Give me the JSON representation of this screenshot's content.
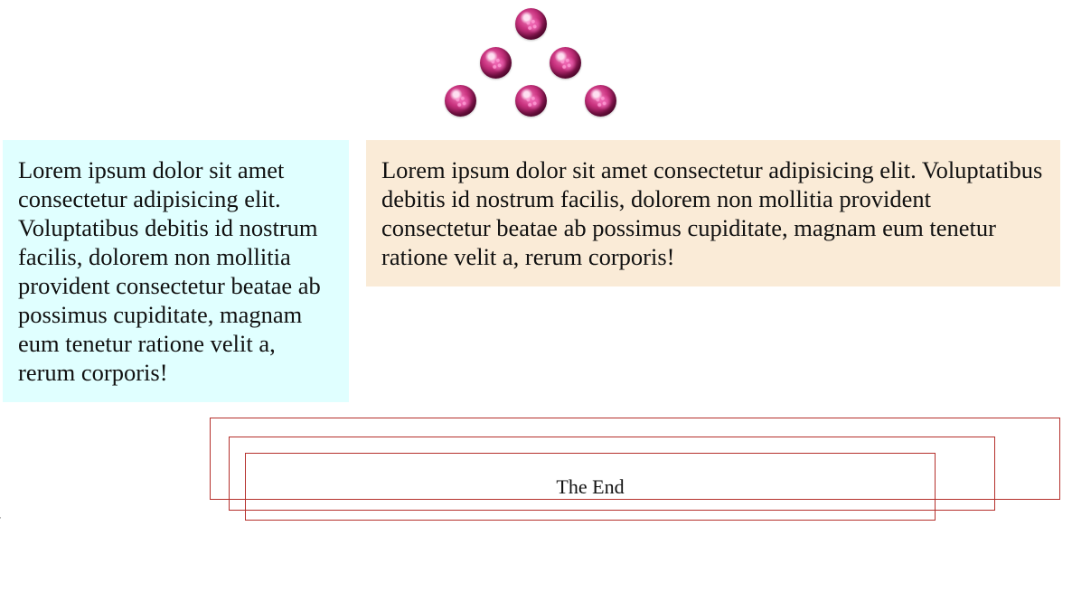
{
  "balls": {
    "count": 6,
    "color": "#c9337f"
  },
  "boxes": {
    "left": {
      "text": "Lorem ipsum dolor sit amet consectetur adipisicing elit. Voluptatibus debitis id nostrum facilis, dolorem non mollitia provident consectetur beatae ab possimus cupiditate, magnam eum tenetur ratione velit a, rerum corporis!",
      "background": "#e0ffff"
    },
    "right": {
      "text": "Lorem ipsum dolor sit amet consectetur adipisicing elit. Voluptatibus debitis id nostrum facilis, dolorem non mollitia provident consectetur beatae ab possimus cupiditate, magnam eum tenetur ratione velit a, rerum corporis!",
      "background": "#faebd7"
    }
  },
  "frames": {
    "border_color": "#b5302c",
    "end_text": "The End"
  }
}
